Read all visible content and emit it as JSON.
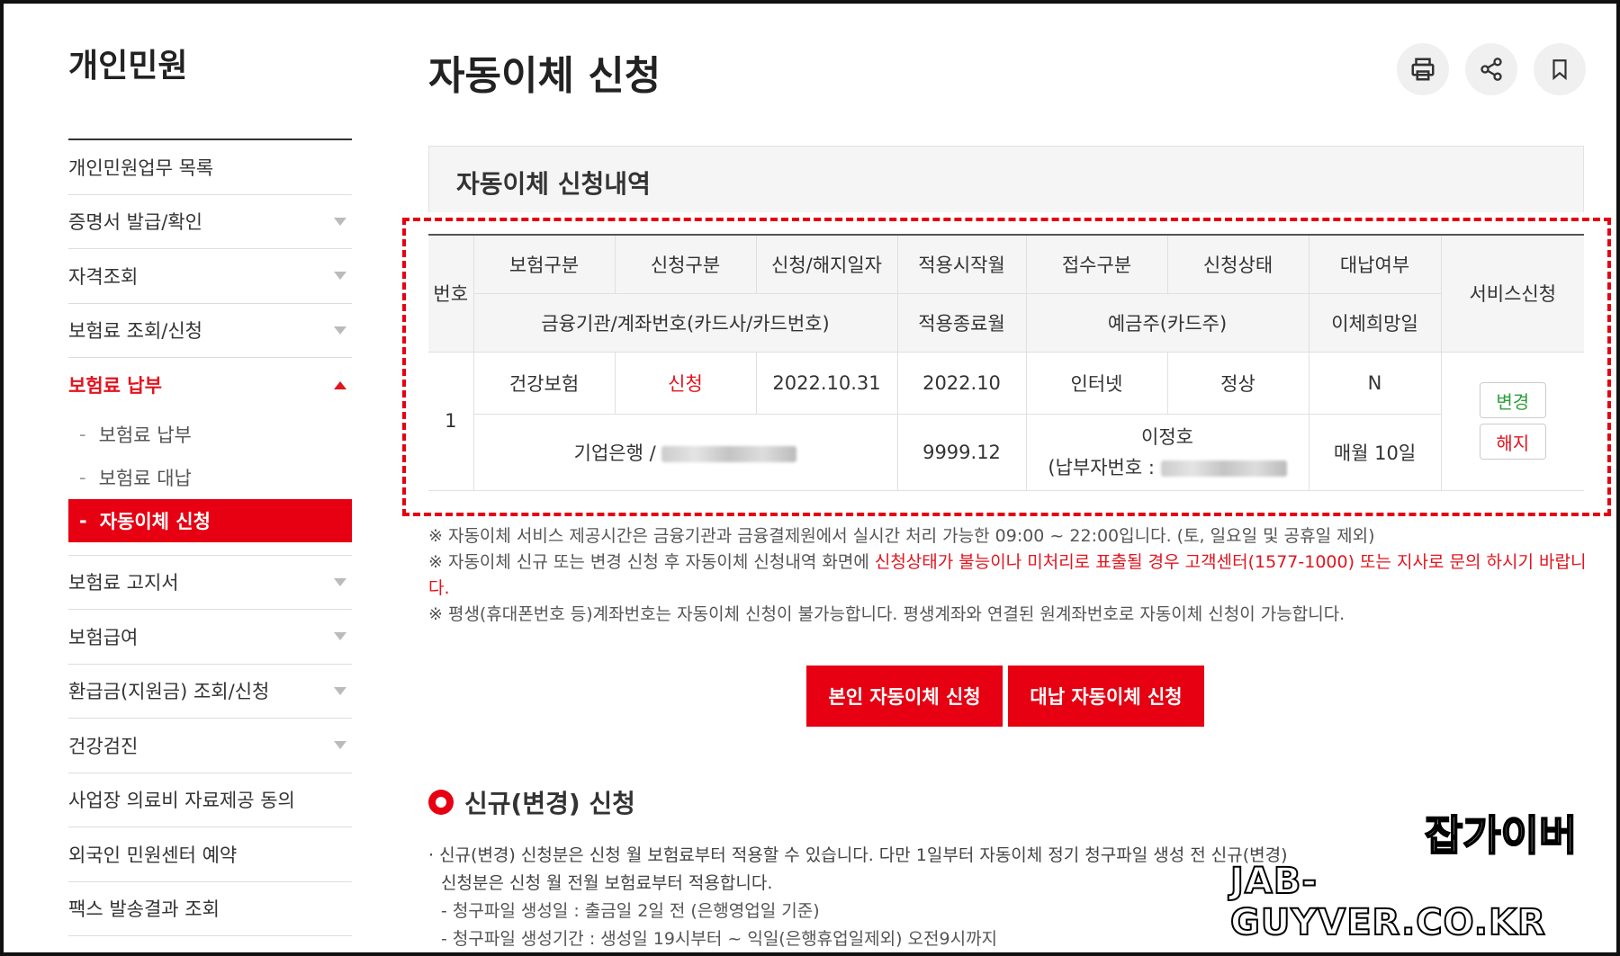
{
  "sidebar": {
    "title": "개인민원",
    "items": [
      {
        "label": "개인민원업무 목록"
      },
      {
        "label": "증명서 발급/확인"
      },
      {
        "label": "자격조회"
      },
      {
        "label": "보험료 조회/신청"
      },
      {
        "label": "보험료 납부"
      },
      {
        "label": "보험료 고지서"
      },
      {
        "label": "보험급여"
      },
      {
        "label": "환급금(지원금) 조회/신청"
      },
      {
        "label": "건강검진"
      },
      {
        "label": "사업장 의료비 자료제공 동의"
      },
      {
        "label": "외국인 민원센터 예약"
      },
      {
        "label": "팩스 발송결과 조회"
      }
    ],
    "sub_items": [
      {
        "label": "보험료 납부"
      },
      {
        "label": "보험료 대납"
      },
      {
        "label": "자동이체 신청"
      }
    ],
    "sub_dash": "-"
  },
  "page": {
    "title": "자동이체 신청",
    "tools": [
      "print-icon",
      "share-icon",
      "bookmark-icon"
    ]
  },
  "history": {
    "title": "자동이체 신청내역",
    "headers": {
      "no": "번호",
      "row1": [
        "보험구분",
        "신청구분",
        "신청/해지일자",
        "적용시작월",
        "접수구분",
        "신청상태",
        "대납여부"
      ],
      "service": "서비스신청",
      "bank": "금융기관/계좌번호(카드사/카드번호)",
      "end_month": "적용종료월",
      "depositor": "예금주(카드주)",
      "pay_day": "이체희망일"
    },
    "row": {
      "no": "1",
      "insurance": "건강보험",
      "apply_type": "신청",
      "date": "2022.10.31",
      "start_month": "2022.10",
      "channel": "인터넷",
      "status": "정상",
      "proxy": "N",
      "bank": "기업은행 /",
      "end_month": "9999.12",
      "depositor": "이정호",
      "payer_label": "(납부자번호 :",
      "pay_day": "매월 10일",
      "btn_change": "변경",
      "btn_cancel": "해지"
    }
  },
  "notes": {
    "n1": "※ 자동이체 서비스 제공시간은 금융기관과 금융결제원에서 실시간 처리 가능한 09:00 ~ 22:00입니다. (토, 일요일 및 공휴일 제외)",
    "n2_prefix": "※ 자동이체 신규 또는 변경 신청 후 자동이체 신청내역 화면에 ",
    "n2_red": "신청상태가 불능이나 미처리로 표출될 경우 고객센터(1577-1000) 또는 지사로 문의 하시기 바랍니다.",
    "n3": "※ 평생(휴대폰번호 등)계좌번호는 자동이체 신청이 불가능합니다. 평생계좌와 연결된 원계좌번호로 자동이체 신청이 가능합니다."
  },
  "buttons": {
    "self": "본인 자동이체 신청",
    "proxy": "대납 자동이체 신청"
  },
  "new_section": {
    "title": "신규(변경) 신청",
    "p1": "· 신규(변경) 신청분은 신청 월 보험료부터 적용할 수 있습니다. 다만 1일부터 자동이체 정기 청구파일 생성 전 신규(변경)",
    "p1b": "신청분은 신청 월 전월 보험료부터 적용합니다.",
    "p2": "- 청구파일 생성일 : 출금일 2일 전 (은행영업일 기준)",
    "p3": "- 청구파일 생성기간 : 생성일 19시부터 ~ 익일(은행휴업일제외) 오전9시까지"
  },
  "watermark": {
    "line1": "잡가이버",
    "line2": "JAB-GUYVER.CO.KR"
  }
}
